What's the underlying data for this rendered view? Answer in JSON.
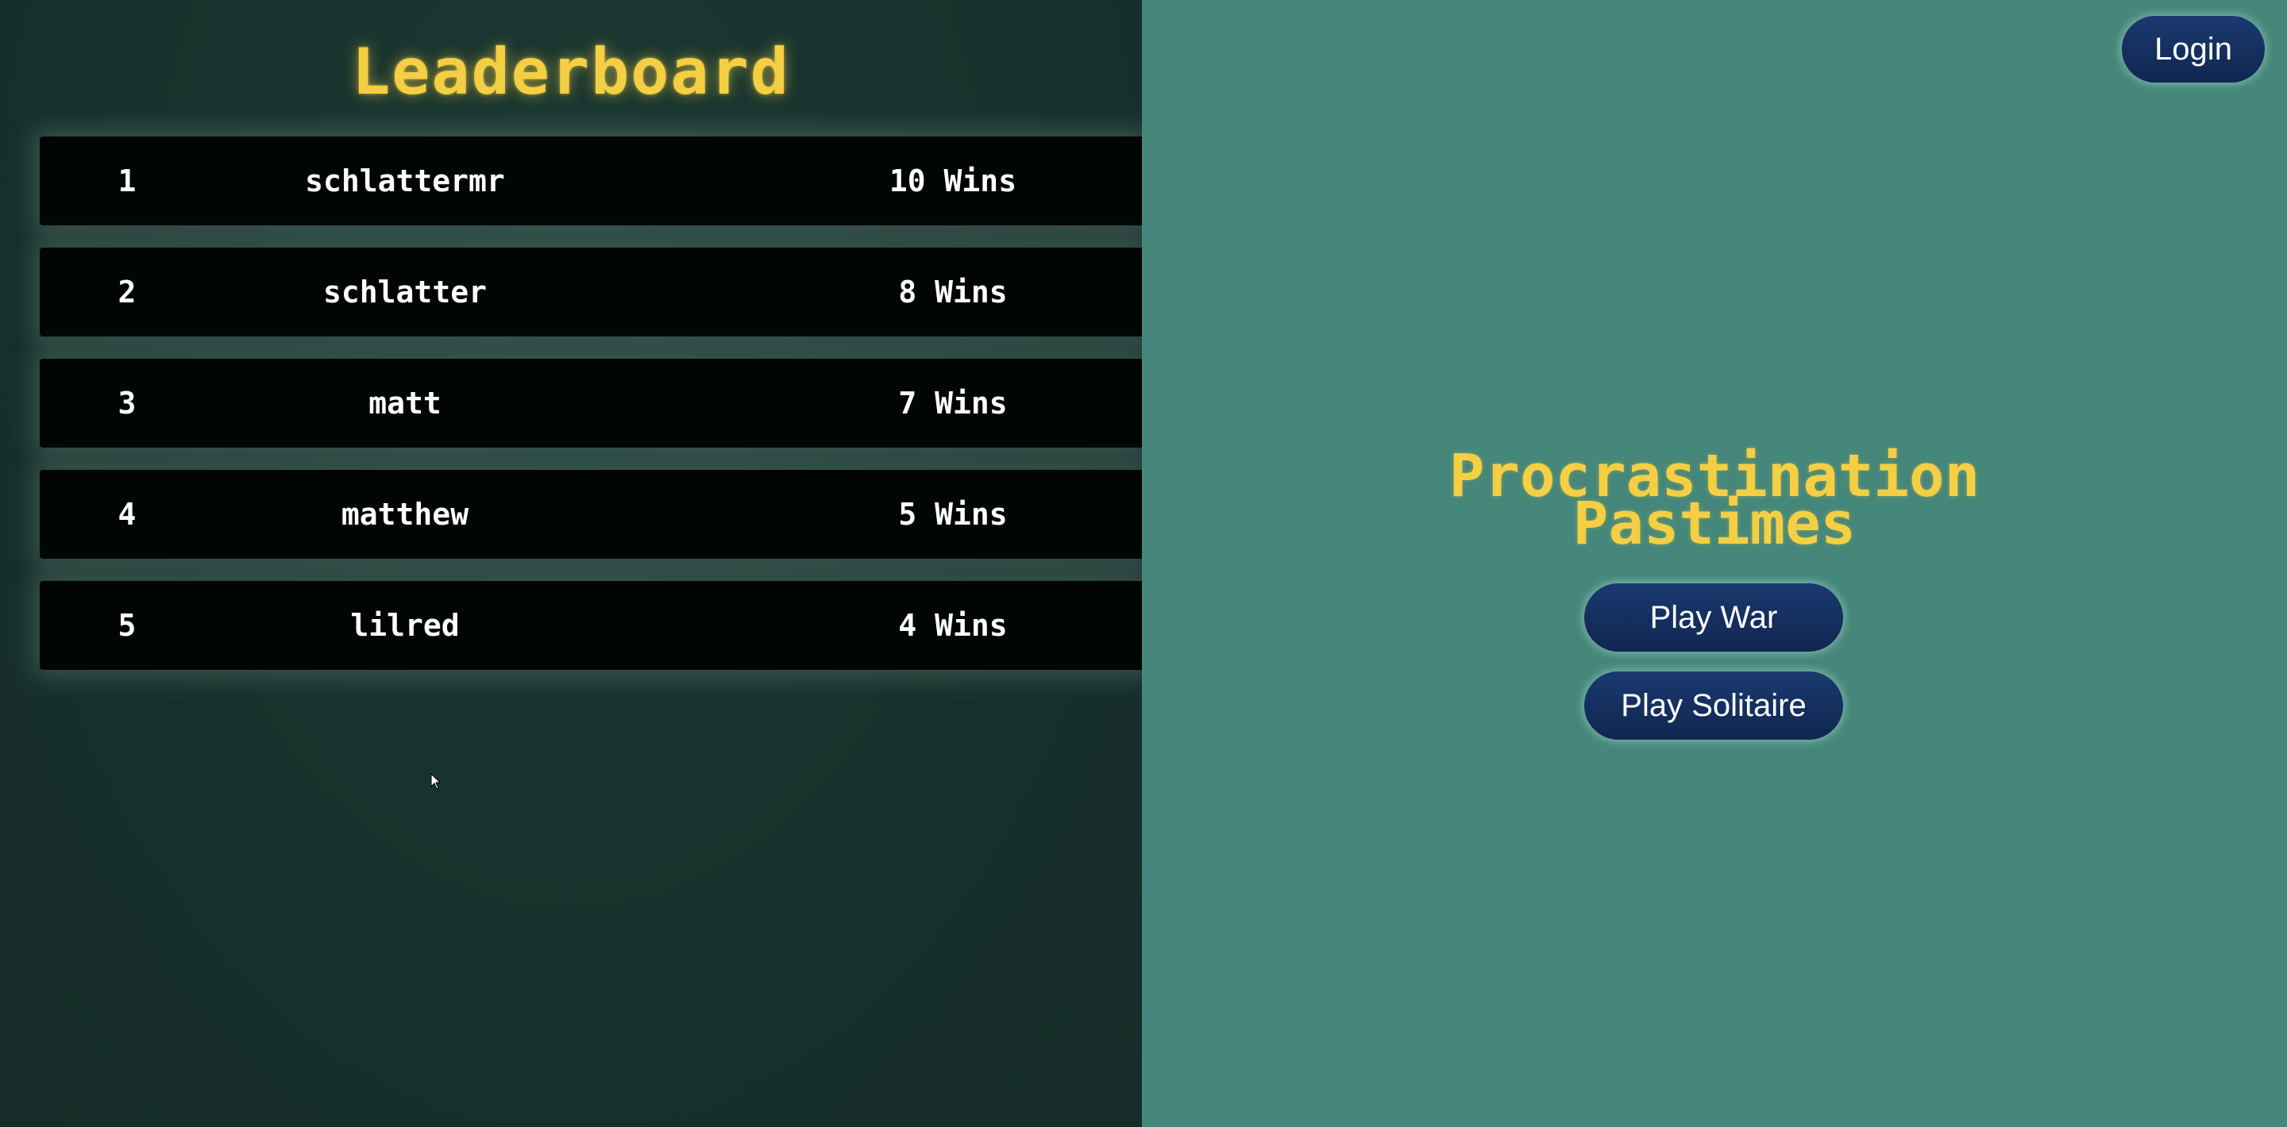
{
  "leaderboard": {
    "title": "Leaderboard",
    "rows": [
      {
        "rank": "1",
        "name": "schlattermr",
        "wins": "10 Wins"
      },
      {
        "rank": "2",
        "name": "schlatter",
        "wins": "8 Wins"
      },
      {
        "rank": "3",
        "name": "matt",
        "wins": "7 Wins"
      },
      {
        "rank": "4",
        "name": "matthew",
        "wins": "5 Wins"
      },
      {
        "rank": "5",
        "name": "lilred",
        "wins": "4 Wins"
      }
    ]
  },
  "header": {
    "login_label": "Login"
  },
  "main": {
    "title_line1": "Procrastination",
    "title_line2": "Pastimes",
    "play_war_label": "Play War",
    "play_solitaire_label": "Play Solitaire"
  },
  "colors": {
    "accent_yellow": "#f4cf44",
    "left_background": "#18312c",
    "right_background": "#45877a",
    "button_navy": "#102650",
    "row_background": "#010605"
  },
  "icons": {
    "cursor": "mouse-pointer-icon"
  }
}
